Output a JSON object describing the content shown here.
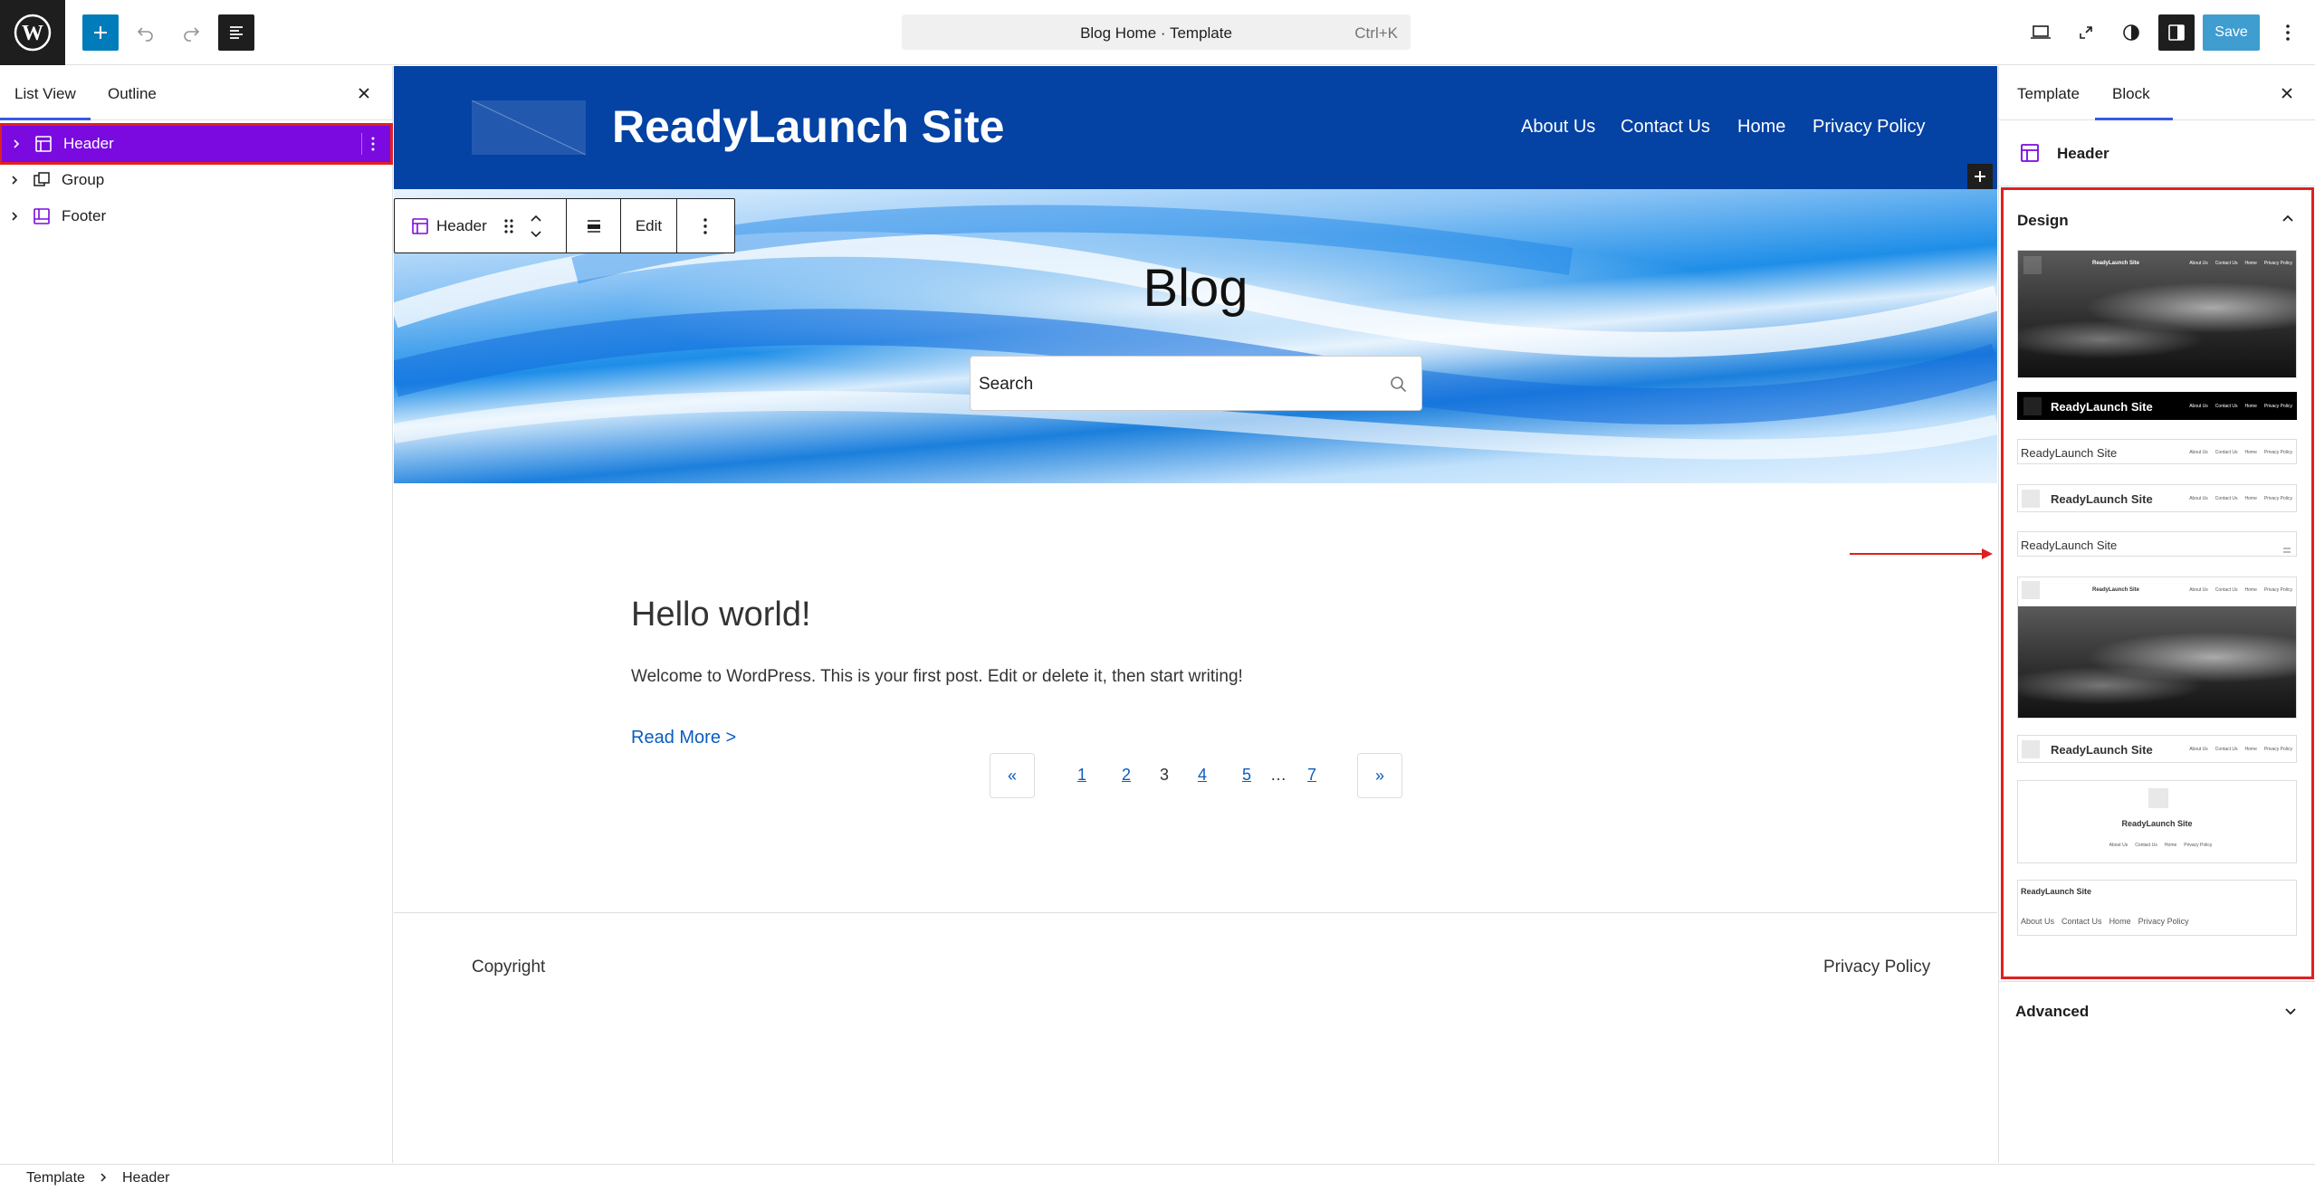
{
  "topbar": {
    "command_title": "Blog Home · Template",
    "command_shortcut": "Ctrl+K",
    "save_label": "Save"
  },
  "left_panel": {
    "tabs": [
      "List View",
      "Outline"
    ],
    "items": [
      {
        "label": "Header",
        "selected": true
      },
      {
        "label": "Group",
        "selected": false
      },
      {
        "label": "Footer",
        "selected": false
      }
    ]
  },
  "site": {
    "title": "ReadyLaunch Site",
    "nav": [
      "About Us",
      "Contact Us",
      "Home",
      "Privacy Policy"
    ],
    "hero_title": "Blog",
    "search_placeholder": "Search",
    "block_toolbar": {
      "block_name": "Header",
      "edit_label": "Edit"
    },
    "post": {
      "title": "Hello world!",
      "excerpt": "Welcome to WordPress. This is your first post. Edit or delete it, then start writing!",
      "read_more": "Read More >"
    },
    "pagination": {
      "prev": "«",
      "next": "»",
      "pages": [
        "1",
        "2",
        "3",
        "4",
        "5",
        "…",
        "7"
      ],
      "current": "3"
    },
    "footer": {
      "copyright": "Copyright",
      "privacy": "Privacy Policy"
    }
  },
  "right_panel": {
    "tabs": [
      "Template",
      "Block"
    ],
    "block_name": "Header",
    "design_title": "Design",
    "advanced_title": "Advanced",
    "variations": [
      {
        "title": "ReadyLaunch Site",
        "links": [
          "About Us",
          "Contact Us",
          "Home",
          "Privacy Policy"
        ]
      },
      {
        "title": "ReadyLaunch Site",
        "links": [
          "About Us",
          "Contact Us",
          "Home",
          "Privacy Policy"
        ]
      },
      {
        "title": "ReadyLaunch Site",
        "links": [
          "About Us",
          "Contact Us",
          "Home",
          "Privacy Policy"
        ]
      },
      {
        "title": "ReadyLaunch Site",
        "links": [
          "About Us",
          "Contact Us",
          "Home",
          "Privacy Policy"
        ]
      },
      {
        "title": "ReadyLaunch Site",
        "links": []
      },
      {
        "title": "ReadyLaunch Site",
        "links": [
          "About Us",
          "Contact Us",
          "Home",
          "Privacy Policy"
        ]
      },
      {
        "title": "ReadyLaunch Site",
        "links": [
          "About Us",
          "Contact Us",
          "Home",
          "Privacy Policy"
        ]
      },
      {
        "title": "ReadyLaunch Site",
        "links": [
          "About Us",
          "Contact Us",
          "Home",
          "Privacy Policy"
        ]
      },
      {
        "title": "ReadyLaunch Site",
        "links": [
          "About Us",
          "Contact Us",
          "Home",
          "Privacy Policy"
        ]
      }
    ]
  },
  "breadcrumb": [
    "Template",
    "Header"
  ],
  "colors": {
    "accent": "#3858e9",
    "header_bg": "#0442a4",
    "selected_item": "#7a0ae0",
    "highlight_border": "#e02020",
    "link": "#0a5cc2"
  }
}
